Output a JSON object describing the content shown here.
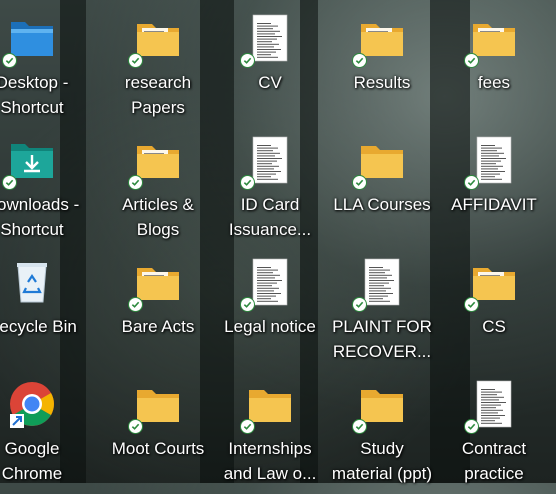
{
  "desktop": {
    "icons": [
      {
        "id": "desktop-shortcut",
        "label": "Desktop -\nShortcut",
        "type": "desktop-folder",
        "icon": "blue-desktop-folder-icon",
        "synced": true
      },
      {
        "id": "research-papers",
        "label": "research\nPapers",
        "type": "folder",
        "icon": "folder-icon",
        "synced": true
      },
      {
        "id": "cv",
        "label": "CV",
        "type": "document",
        "icon": "document-icon",
        "synced": true
      },
      {
        "id": "results",
        "label": "Results",
        "type": "folder",
        "icon": "folder-icon",
        "synced": true
      },
      {
        "id": "fees",
        "label": "fees",
        "type": "folder",
        "icon": "folder-icon",
        "synced": true
      },
      {
        "id": "downloads-shortcut",
        "label": "Downloads -\nShortcut",
        "type": "downloads-folder",
        "icon": "download-folder-icon",
        "synced": true
      },
      {
        "id": "articles-blogs",
        "label": "Articles &\nBlogs",
        "type": "folder",
        "icon": "folder-icon",
        "synced": true
      },
      {
        "id": "id-card",
        "label": "ID Card\nIssuance...",
        "type": "document",
        "icon": "document-icon",
        "synced": true
      },
      {
        "id": "lla-courses",
        "label": "LLA Courses",
        "type": "folder-plain",
        "icon": "folder-icon",
        "synced": true
      },
      {
        "id": "affidavit",
        "label": "AFFIDAVIT",
        "type": "document",
        "icon": "document-icon",
        "synced": true
      },
      {
        "id": "recycle-bin",
        "label": "Recycle Bin",
        "type": "recycle",
        "icon": "recycle-bin-icon",
        "synced": false
      },
      {
        "id": "bare-acts",
        "label": "Bare Acts",
        "type": "folder",
        "icon": "folder-icon",
        "synced": true
      },
      {
        "id": "legal-notice",
        "label": "Legal notice",
        "type": "document",
        "icon": "document-icon",
        "synced": true
      },
      {
        "id": "plaint",
        "label": "PLAINT FOR\nRECOVER...",
        "type": "document",
        "icon": "document-icon",
        "synced": true
      },
      {
        "id": "cs",
        "label": "CS",
        "type": "folder",
        "icon": "folder-icon",
        "synced": true
      },
      {
        "id": "google-chrome",
        "label": "Google\nChrome",
        "type": "chrome",
        "icon": "chrome-icon",
        "synced": false
      },
      {
        "id": "moot-courts",
        "label": "Moot Courts",
        "type": "folder-doc",
        "icon": "folder-icon",
        "synced": true
      },
      {
        "id": "internships",
        "label": "Internships\nand Law o...",
        "type": "folder-doc",
        "icon": "folder-icon",
        "synced": true
      },
      {
        "id": "study-material",
        "label": "Study\nmaterial (ppt)",
        "type": "folder-plain",
        "icon": "folder-icon",
        "synced": true
      },
      {
        "id": "contract-practice",
        "label": "Contract\npractice",
        "type": "document",
        "icon": "document-icon",
        "synced": true
      }
    ]
  },
  "colors": {
    "folder_yellow": "#f5c550",
    "folder_back": "#e8a930",
    "sync_green": "#2d8a3e",
    "desktop_blue": "#2f8fe0",
    "downloads_teal": "#1da69a",
    "chrome_red": "#db4437",
    "chrome_yellow": "#f4b400",
    "chrome_green": "#0f9d58",
    "chrome_blue": "#4285f4"
  }
}
